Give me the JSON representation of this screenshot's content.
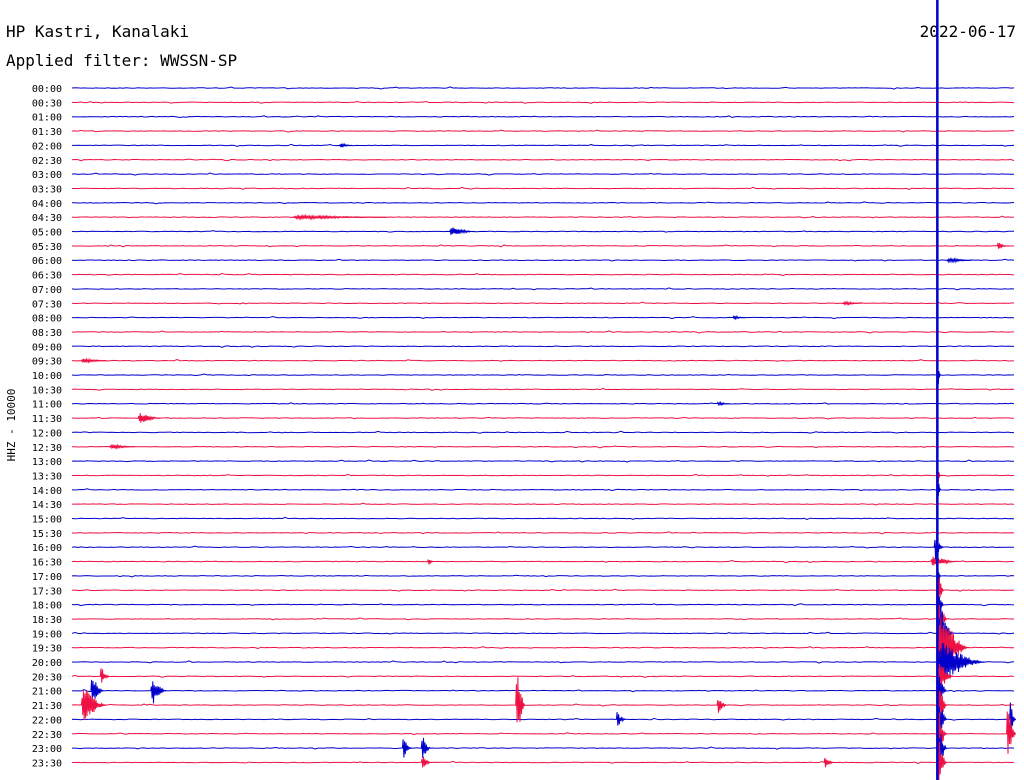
{
  "header": {
    "station": "HP Kastri, Kanalaki",
    "date": "2022-06-17",
    "filter": "Applied filter: WWSSN-SP"
  },
  "side_label": "HHZ - 10000",
  "colors": {
    "odd": "#0000cc",
    "even": "#ee1144",
    "background": "#ffffff"
  },
  "chart_data": {
    "type": "line",
    "title": "HP Kastri, Kanalaki",
    "ylabel": "HHZ - 10000",
    "row_labels": [
      "00:00",
      "00:30",
      "01:00",
      "01:30",
      "02:00",
      "02:30",
      "03:00",
      "03:30",
      "04:00",
      "04:30",
      "05:00",
      "05:30",
      "06:00",
      "06:30",
      "07:00",
      "07:30",
      "08:00",
      "08:30",
      "09:00",
      "09:30",
      "10:00",
      "10:30",
      "11:00",
      "11:30",
      "12:00",
      "12:30",
      "13:00",
      "13:30",
      "14:00",
      "14:30",
      "15:00",
      "15:30",
      "16:00",
      "16:30",
      "17:00",
      "17:30",
      "18:00",
      "18:30",
      "19:00",
      "19:30",
      "20:00",
      "20:30",
      "21:00",
      "21:30",
      "22:00",
      "22:30",
      "23:00",
      "23:30"
    ],
    "row_minutes": 30,
    "grid": false,
    "events": [
      {
        "row": "02:00",
        "minute": 8.5,
        "amplitude": 0.15,
        "duration": 0.4
      },
      {
        "row": "04:30",
        "minute": 7,
        "amplitude": 0.12,
        "duration": 3
      },
      {
        "row": "05:00",
        "minute": 12,
        "amplitude": 0.3,
        "duration": 0.8
      },
      {
        "row": "05:30",
        "minute": 29.4,
        "amplitude": 0.25,
        "duration": 0.3
      },
      {
        "row": "06:00",
        "minute": 27.8,
        "amplitude": 0.15,
        "duration": 0.8
      },
      {
        "row": "07:30",
        "minute": 24.5,
        "amplitude": 0.12,
        "duration": 0.6
      },
      {
        "row": "08:00",
        "minute": 21,
        "amplitude": 0.12,
        "duration": 0.4
      },
      {
        "row": "09:30",
        "minute": 0.3,
        "amplitude": 0.15,
        "duration": 0.8
      },
      {
        "row": "10:00",
        "minute": 27.5,
        "amplitude": 1.0,
        "duration": 0.1
      },
      {
        "row": "11:00",
        "minute": 20.5,
        "amplitude": 0.12,
        "duration": 0.4
      },
      {
        "row": "11:30",
        "minute": 2.1,
        "amplitude": 0.35,
        "duration": 0.7
      },
      {
        "row": "12:30",
        "minute": 1.2,
        "amplitude": 0.15,
        "duration": 0.8
      },
      {
        "row": "13:30",
        "minute": 27.5,
        "amplitude": 0.9,
        "duration": 0.1
      },
      {
        "row": "14:00",
        "minute": 27.5,
        "amplitude": 1.2,
        "duration": 0.1
      },
      {
        "row": "16:00",
        "minute": 27.4,
        "amplitude": 1.0,
        "duration": 0.3
      },
      {
        "row": "16:30",
        "minute": 27.3,
        "amplitude": 0.4,
        "duration": 0.8
      },
      {
        "row": "16:30",
        "minute": 11.3,
        "amplitude": 0.25,
        "duration": 0.2
      },
      {
        "row": "17:00",
        "minute": 27.5,
        "amplitude": 1.2,
        "duration": 0.1
      },
      {
        "row": "17:30",
        "minute": 27.5,
        "amplitude": 1.5,
        "duration": 0.2
      },
      {
        "row": "18:00",
        "minute": 27.5,
        "amplitude": 1.5,
        "duration": 0.2
      },
      {
        "row": "18:30",
        "minute": 27.5,
        "amplitude": 2.5,
        "duration": 0.3
      },
      {
        "row": "19:00",
        "minute": 27.5,
        "amplitude": 2.5,
        "duration": 0.5
      },
      {
        "row": "19:30",
        "minute": 27.5,
        "amplitude": 2.5,
        "duration": 1.0
      },
      {
        "row": "20:00",
        "minute": 27.5,
        "amplitude": 1.5,
        "duration": 1.5
      },
      {
        "row": "20:30",
        "minute": 27.5,
        "amplitude": 1.2,
        "duration": 0.5
      },
      {
        "row": "20:30",
        "minute": 0.9,
        "amplitude": 0.6,
        "duration": 0.3
      },
      {
        "row": "21:00",
        "minute": 0.6,
        "amplitude": 1.2,
        "duration": 0.4
      },
      {
        "row": "21:00",
        "minute": 2.5,
        "amplitude": 1.0,
        "duration": 0.5
      },
      {
        "row": "21:00",
        "minute": 27.5,
        "amplitude": 1.5,
        "duration": 0.3
      },
      {
        "row": "21:30",
        "minute": 0.3,
        "amplitude": 1.2,
        "duration": 0.8
      },
      {
        "row": "21:30",
        "minute": 14.1,
        "amplitude": 2.8,
        "duration": 0.3
      },
      {
        "row": "21:30",
        "minute": 20.5,
        "amplitude": 0.6,
        "duration": 0.3
      },
      {
        "row": "21:30",
        "minute": 27.5,
        "amplitude": 2.0,
        "duration": 0.3
      },
      {
        "row": "22:00",
        "minute": 17.3,
        "amplitude": 0.5,
        "duration": 0.3
      },
      {
        "row": "22:00",
        "minute": 27.5,
        "amplitude": 2.0,
        "duration": 0.3
      },
      {
        "row": "22:00",
        "minute": 29.8,
        "amplitude": 1.2,
        "duration": 0.3
      },
      {
        "row": "22:30",
        "minute": 29.7,
        "amplitude": 2.0,
        "duration": 0.4
      },
      {
        "row": "22:30",
        "minute": 27.5,
        "amplitude": 2.0,
        "duration": 0.3
      },
      {
        "row": "23:00",
        "minute": 10.5,
        "amplitude": 0.7,
        "duration": 0.3
      },
      {
        "row": "23:00",
        "minute": 11.1,
        "amplitude": 0.9,
        "duration": 0.3
      },
      {
        "row": "23:00",
        "minute": 27.5,
        "amplitude": 2.0,
        "duration": 0.3
      },
      {
        "row": "23:30",
        "minute": 11.1,
        "amplitude": 0.5,
        "duration": 0.3
      },
      {
        "row": "23:30",
        "minute": 23.9,
        "amplitude": 0.4,
        "duration": 0.3
      },
      {
        "row": "23:30",
        "minute": 27.5,
        "amplitude": 2.0,
        "duration": 0.3
      }
    ],
    "marker": {
      "minute": 27.5
    }
  }
}
